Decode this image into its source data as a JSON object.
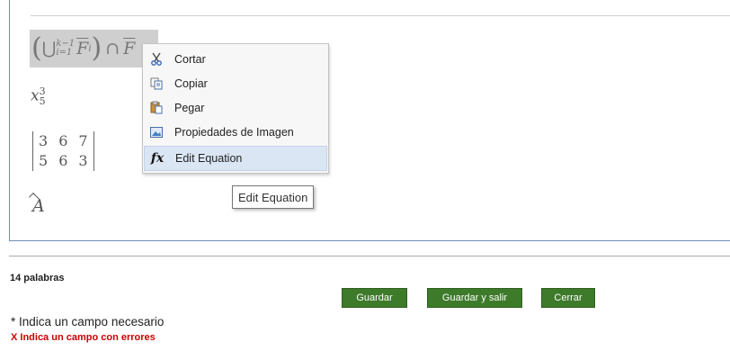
{
  "editor": {
    "equations": {
      "union_sup": "k−1",
      "union_sub": "i=1",
      "F": "F",
      "i": "i",
      "cap": "∩",
      "x": "x",
      "x_sup": "3",
      "x_sub": "5",
      "matrix_rows": [
        [
          "3",
          "6",
          "7"
        ],
        [
          "5",
          "6",
          "3"
        ]
      ],
      "A": "A"
    }
  },
  "context_menu": {
    "items": [
      {
        "label": "Cortar",
        "icon": "scissors-icon"
      },
      {
        "label": "Copiar",
        "icon": "copy-icon"
      },
      {
        "label": "Pegar",
        "icon": "paste-icon"
      },
      {
        "label": "Propiedades de Imagen",
        "icon": "image-icon"
      },
      {
        "label": "Edit Equation",
        "icon": "fx-icon"
      }
    ],
    "highlight_color": "#dbe6f4"
  },
  "tooltip": "Edit Equation",
  "footer": {
    "word_count": "14 palabras",
    "buttons": {
      "save": "Guardar",
      "save_exit": "Guardar y salir",
      "close": "Cerrar"
    },
    "button_color": "#3d7a2a",
    "required_note": "* Indica un campo necesario",
    "error_note": "X Indica un campo con errores",
    "error_color": "#cc0000"
  }
}
